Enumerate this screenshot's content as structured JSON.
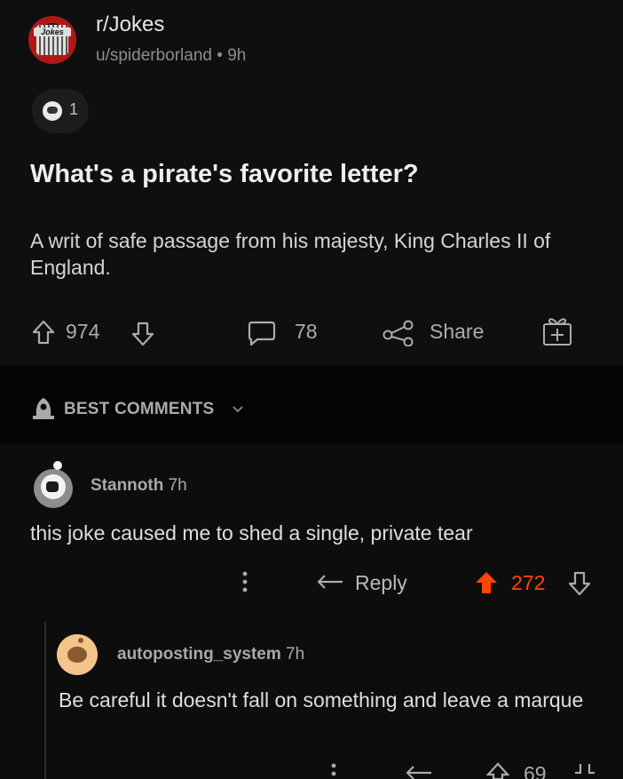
{
  "post": {
    "subreddit": "r/Jokes",
    "subreddit_logo_text": "Jokes",
    "author": "u/spiderborland",
    "separator": "•",
    "age": "9h",
    "award_count": "1",
    "title": "What's a pirate's favorite letter?",
    "body": "A writ of safe passage from his majesty, King Charles II of England.",
    "upvotes": "974",
    "comments": "78",
    "share_label": "Share"
  },
  "sort": {
    "label": "BEST COMMENTS"
  },
  "comments": [
    {
      "author": "Stannoth",
      "age": "7h",
      "text": "this joke caused me to shed a single, private tear",
      "reply_label": "Reply",
      "score": "272"
    },
    {
      "author": "autoposting_system",
      "age": "7h",
      "text": "Be careful it doesn't fall on something and leave a marque",
      "score": "69"
    }
  ],
  "colors": {
    "upvote_active": "#ff4500",
    "background": "#0f0f10",
    "text": "#d7dadc"
  }
}
